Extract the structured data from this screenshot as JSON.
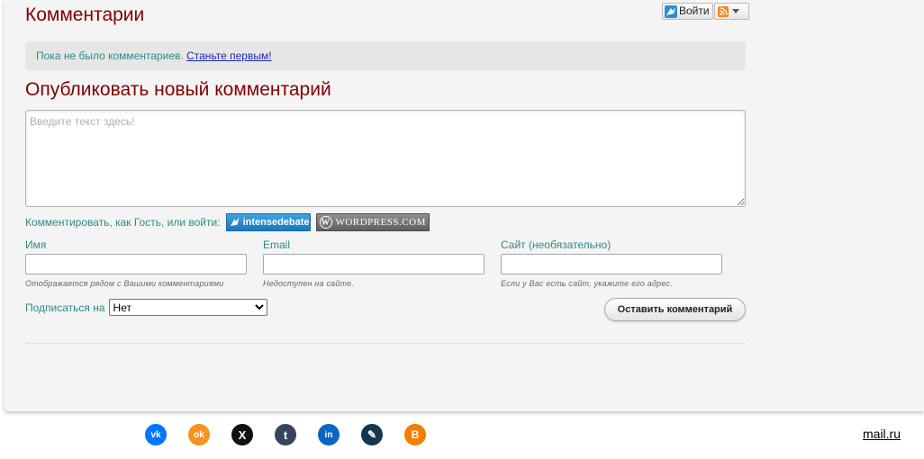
{
  "comments": {
    "title": "Комментарии",
    "login_label": "Войти",
    "no_comments_text": "Пока не было комментариев.",
    "be_first_link": "Станьте первым!"
  },
  "new_comment": {
    "title": "Опубликовать новый комментарий",
    "textarea_placeholder": "Введите текст здесь!",
    "as_guest_text": "Комментировать, как Гость, или войти:",
    "intensedebate_label": "intensedebate",
    "wordpress_label": "WORDPRESS.COM",
    "fields": [
      {
        "label": "Имя",
        "hint": "Отображается рядом с Вашими комментариями"
      },
      {
        "label": "Email",
        "hint": "Недоступен на сайте."
      },
      {
        "label": "Сайт (необязательно)",
        "hint": "Если у Вас есть сайт, укажите его адрес."
      }
    ],
    "subscribe_label": "Подписаться на",
    "subscribe_selected": "Нет",
    "submit_label": "Оставить комментарий"
  },
  "footer": {
    "social_icons": [
      {
        "name": "vk-icon",
        "glyph": "vk",
        "color": "#0077ff"
      },
      {
        "name": "odnoklassniki-icon",
        "glyph": "ok",
        "color": "#f7931e"
      },
      {
        "name": "x-icon",
        "glyph": "X",
        "color": "#111111"
      },
      {
        "name": "tumblr-icon",
        "glyph": "t",
        "color": "#35465c"
      },
      {
        "name": "linkedin-icon",
        "glyph": "in",
        "color": "#0a66c2"
      },
      {
        "name": "livejournal-icon",
        "glyph": "✎",
        "color": "#15374c"
      },
      {
        "name": "blogger-icon",
        "glyph": "B",
        "color": "#f57d00"
      }
    ],
    "mail_link": "mail.ru"
  },
  "colors": {
    "heading": "#800000",
    "teal_text": "#2a8a8a",
    "panel_bg": "#f4f4f4"
  }
}
